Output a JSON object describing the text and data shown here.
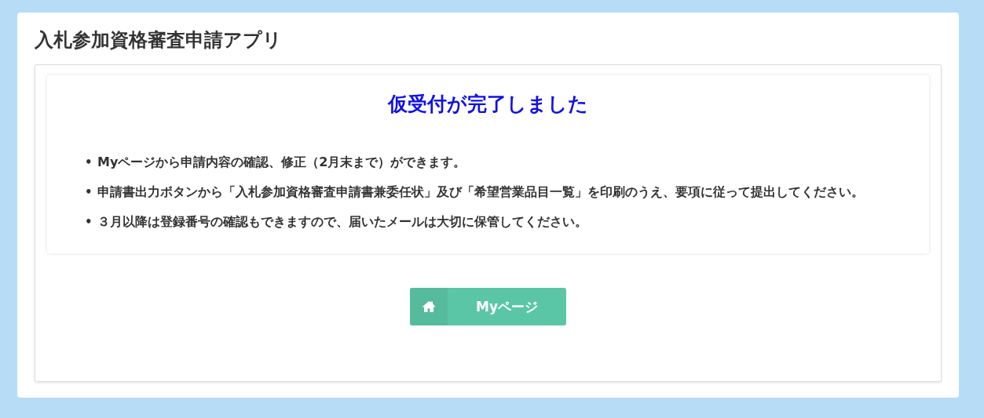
{
  "app_title": "入札参加資格審査申請アプリ",
  "message": {
    "heading": "仮受付が完了しました",
    "items": [
      {
        "bullet": "•",
        "text": "Myページから申請内容の確認、修正（2月末まで）ができます。"
      },
      {
        "bullet": "•",
        "text": "申請書出力ボタンから「入札参加資格審査申請書兼委任状」及び「希望営業品目一覧」を印刷のうえ、要項に従って提出してください。"
      },
      {
        "bullet": "•",
        "text": "３月以降は登録番号の確認もできますので、届いたメールは大切に保管してください。"
      }
    ]
  },
  "button": {
    "label": "Myページ"
  }
}
